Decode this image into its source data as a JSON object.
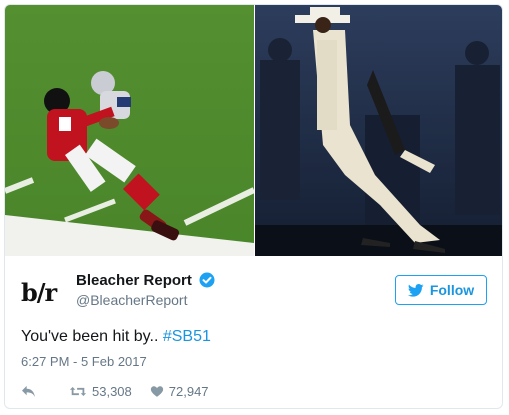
{
  "media": {
    "left_image": "football-catch-photo",
    "right_image": "dancer-lean-photo"
  },
  "author": {
    "logo_text": "b/r",
    "name": "Bleacher Report",
    "handle": "@BleacherReport",
    "verified_icon": "verified-badge-icon"
  },
  "follow_button": {
    "label": "Follow",
    "icon": "bird-icon"
  },
  "tweet": {
    "text_prefix": "You've been hit by.. ",
    "hashtag": "#SB51",
    "timestamp": "6:27 PM - 5 Feb 2017"
  },
  "actions": {
    "reply_icon": "reply-icon",
    "retweet_icon": "retweet-icon",
    "retweet_count": "53,308",
    "like_icon": "heart-icon",
    "like_count": "72,947"
  },
  "colors": {
    "accent": "#1da1f2",
    "link": "#1b95e0",
    "muted": "#657786",
    "border": "#e1e8ed"
  }
}
